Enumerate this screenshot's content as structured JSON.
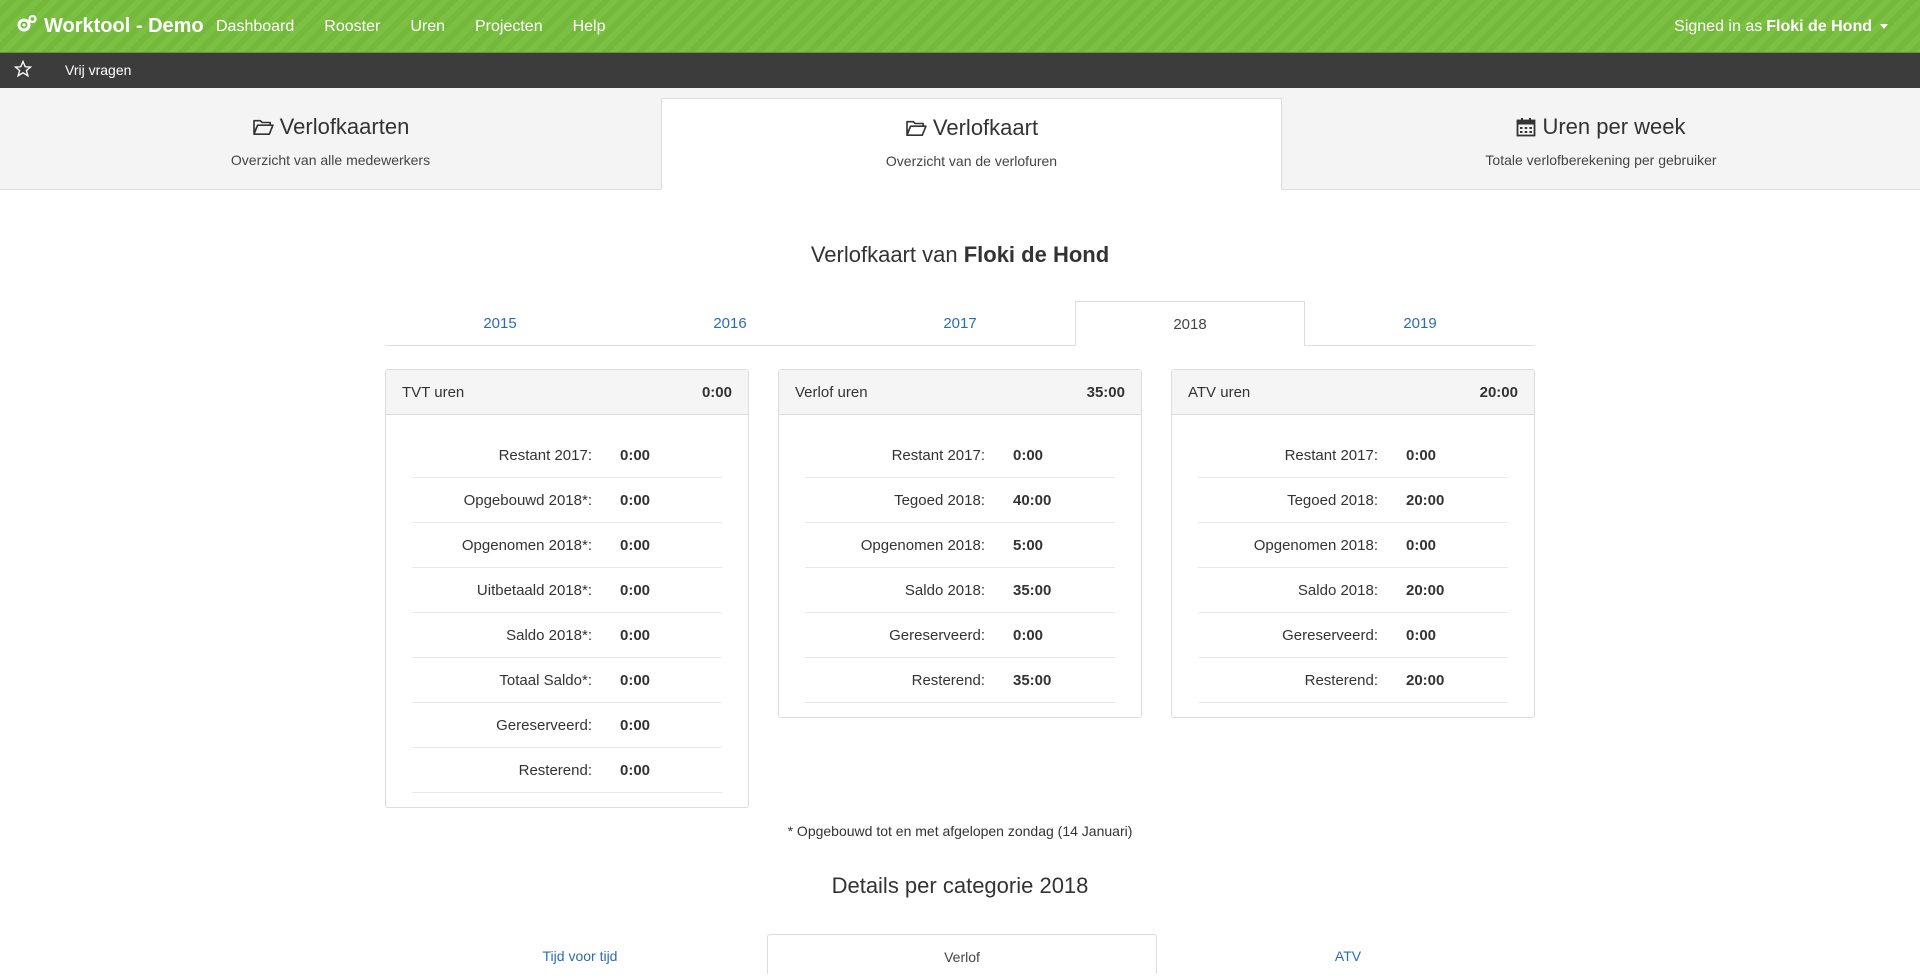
{
  "navbar": {
    "brand": "Worktool - Demo",
    "links": [
      "Dashboard",
      "Rooster",
      "Uren",
      "Projecten",
      "Help"
    ],
    "signed_prefix": "Signed in as",
    "user": "Floki de Hond"
  },
  "subbar": {
    "item": "Vrij vragen"
  },
  "bigtabs": [
    {
      "title": "Verlofkaarten",
      "subtitle": "Overzicht van alle medewerkers",
      "icon": "folder-open-icon"
    },
    {
      "title": "Verlofkaart",
      "subtitle": "Overzicht van de verlofuren",
      "icon": "folder-open-icon"
    },
    {
      "title": "Uren per week",
      "subtitle": "Totale verlofberekening per gebruiker",
      "icon": "calendar-icon"
    }
  ],
  "card_title": {
    "prefix": "Verlofkaart van",
    "name": "Floki de Hond"
  },
  "years": [
    "2015",
    "2016",
    "2017",
    "2018",
    "2019"
  ],
  "active_year": "2018",
  "panels": [
    {
      "title": "TVT uren",
      "total": "0:00",
      "rows": [
        {
          "label": "Restant 2017:",
          "value": "0:00"
        },
        {
          "label": "Opgebouwd 2018*:",
          "value": "0:00"
        },
        {
          "label": "Opgenomen 2018*:",
          "value": "0:00"
        },
        {
          "label": "Uitbetaald 2018*:",
          "value": "0:00"
        },
        {
          "label": "Saldo 2018*:",
          "value": "0:00"
        },
        {
          "label": "Totaal Saldo*:",
          "value": "0:00"
        },
        {
          "label": "Gereserveerd:",
          "value": "0:00"
        },
        {
          "label": "Resterend:",
          "value": "0:00"
        }
      ]
    },
    {
      "title": "Verlof uren",
      "total": "35:00",
      "rows": [
        {
          "label": "Restant 2017:",
          "value": "0:00"
        },
        {
          "label": "Tegoed 2018:",
          "value": "40:00"
        },
        {
          "label": "Opgenomen 2018:",
          "value": "5:00"
        },
        {
          "label": "Saldo 2018:",
          "value": "35:00"
        },
        {
          "label": "Gereserveerd:",
          "value": "0:00"
        },
        {
          "label": "Resterend:",
          "value": "35:00"
        }
      ]
    },
    {
      "title": "ATV uren",
      "total": "20:00",
      "rows": [
        {
          "label": "Restant 2017:",
          "value": "0:00"
        },
        {
          "label": "Tegoed 2018:",
          "value": "20:00"
        },
        {
          "label": "Opgenomen 2018:",
          "value": "0:00"
        },
        {
          "label": "Saldo 2018:",
          "value": "20:00"
        },
        {
          "label": "Gereserveerd:",
          "value": "0:00"
        },
        {
          "label": "Resterend:",
          "value": "20:00"
        }
      ]
    }
  ],
  "footnote": "* Opgebouwd tot en met afgelopen zondag (14 Januari)",
  "details_title": "Details per categorie 2018",
  "categories": [
    "Tijd voor tijd",
    "Verlof",
    "ATV"
  ],
  "colors": {
    "navbar": "#7bc043",
    "subbar": "#3c3c3c",
    "link": "#2a6db5"
  }
}
